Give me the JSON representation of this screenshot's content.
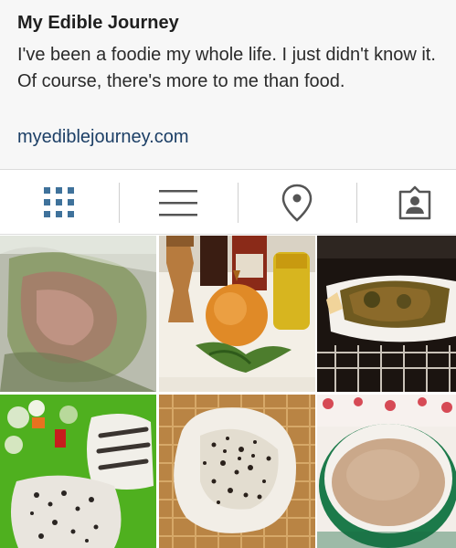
{
  "profile": {
    "name": "My Edible Journey",
    "bio": "I've been a foodie my whole life. I just didn't know it. Of course, there's more to me than food.",
    "website": "myediblejourney.com"
  },
  "toolbar": {
    "active_view": "grid",
    "accent_color": "#3f729b",
    "inactive_color": "#555555",
    "items": [
      {
        "id": "grid",
        "icon": "grid-icon"
      },
      {
        "id": "list",
        "icon": "list-icon"
      },
      {
        "id": "map",
        "icon": "location-pin-icon"
      },
      {
        "id": "tagged",
        "icon": "tagged-user-icon"
      }
    ]
  },
  "photos": [
    {
      "id": "marinated-meat-bag"
    },
    {
      "id": "pepper-mill-onion-sauces"
    },
    {
      "id": "roast-in-oven"
    },
    {
      "id": "fish-with-salad"
    },
    {
      "id": "flatbread-on-rack"
    },
    {
      "id": "dough-in-bowl"
    }
  ]
}
